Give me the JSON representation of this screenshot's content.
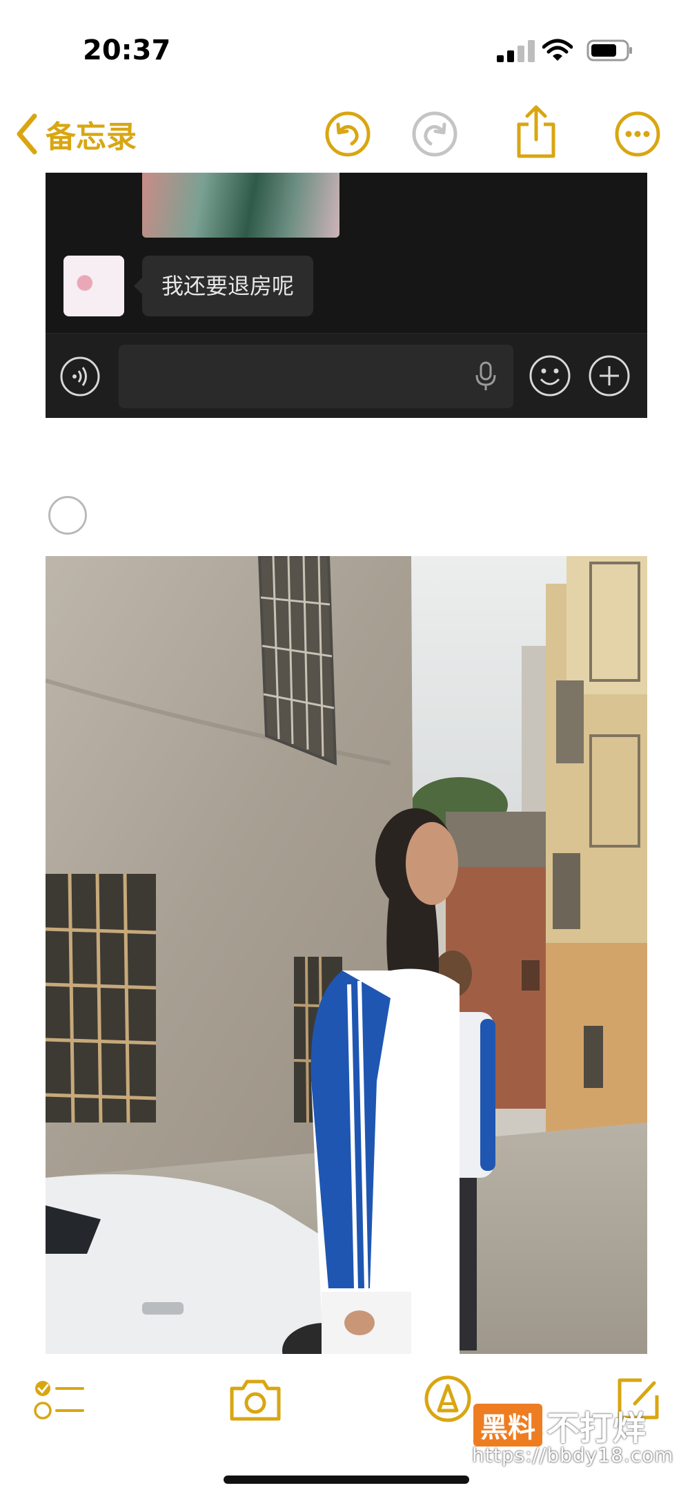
{
  "status_bar": {
    "time": "20:37",
    "signal_icon": "cellular-signal-icon",
    "wifi_icon": "wifi-icon",
    "battery_icon": "battery-icon"
  },
  "nav": {
    "back_label": "备忘录",
    "accent_color": "#d9a612",
    "buttons": [
      "undo-icon",
      "redo-icon",
      "share-icon",
      "more-icon"
    ]
  },
  "chat_screenshot": {
    "message": "我还要退房呢",
    "input_placeholder": "",
    "icons": [
      "voice-icon",
      "mic-icon",
      "emoji-icon",
      "plus-icon"
    ]
  },
  "note": {
    "checklist_item_checked": false
  },
  "toolbar": {
    "buttons": [
      "checklist-icon",
      "camera-icon",
      "markup-icon",
      "compose-icon"
    ]
  },
  "watermark": {
    "badge": "黑料",
    "text": "不打烊",
    "url": "https://bbdy18.com"
  }
}
